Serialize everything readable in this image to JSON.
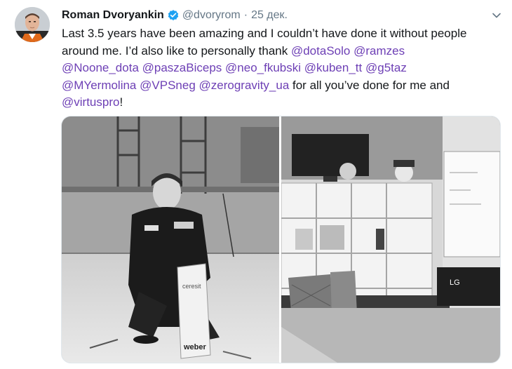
{
  "author": {
    "name": "Roman Dvoryankin",
    "handle": "@dvoryrom",
    "separator": "·",
    "date": "25 дек."
  },
  "tweet": {
    "lines": [
      [
        {
          "text": "Last 3.5 years have been amazing and I couldn’t have done it without people",
          "mention": false
        }
      ],
      [
        {
          "text": "around me. I’d also like to personally thank ",
          "mention": false
        },
        {
          "text": "@dotaSolo",
          "mention": true
        },
        {
          "text": " ",
          "mention": false
        },
        {
          "text": "@ramzes",
          "mention": true
        }
      ],
      [
        {
          "text": "@Noone_dota",
          "mention": true
        },
        {
          "text": " ",
          "mention": false
        },
        {
          "text": "@paszaBiceps",
          "mention": true
        },
        {
          "text": " ",
          "mention": false
        },
        {
          "text": "@neo_fkubski",
          "mention": true
        },
        {
          "text": " ",
          "mention": false
        },
        {
          "text": "@kuben_tt",
          "mention": true
        },
        {
          "text": " ",
          "mention": false
        },
        {
          "text": "@g5taz",
          "mention": true
        }
      ],
      [
        {
          "text": "@MYermolina",
          "mention": true
        },
        {
          "text": " ",
          "mention": false
        },
        {
          "text": "@VPSneg",
          "mention": true
        },
        {
          "text": " ",
          "mention": false
        },
        {
          "text": "@zerogravity_ua",
          "mention": true
        },
        {
          "text": " for all you’ve done for me and",
          "mention": false
        }
      ],
      [
        {
          "text": "@virtuspro",
          "mention": true
        },
        {
          "text": "!",
          "mention": false
        }
      ]
    ]
  },
  "media": {
    "photo_left": {
      "bag_text_top": "ceresit",
      "bag_text_bottom": "weber"
    },
    "photo_right": {
      "appliance_logo": "LG"
    }
  },
  "colors": {
    "mention": "#6d3fb5",
    "verified": "#1da1f2",
    "secondary_text": "#657786"
  },
  "icons": {
    "verified": "verified-badge-icon",
    "more": "chevron-down-icon"
  }
}
